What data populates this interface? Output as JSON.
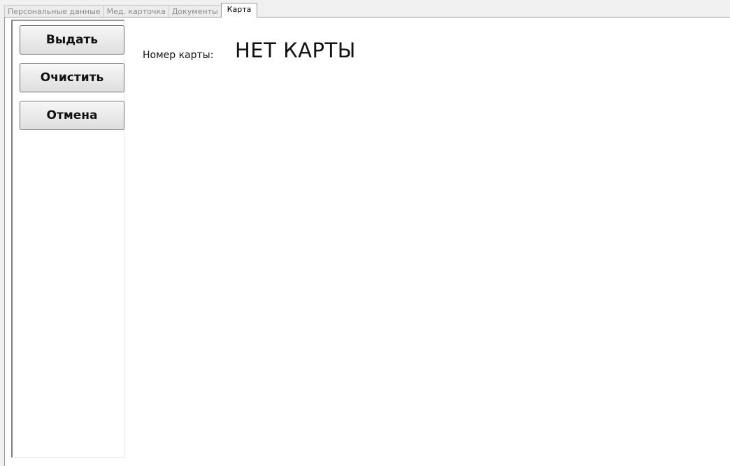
{
  "tabs": [
    {
      "label": "Персональные данные",
      "active": false
    },
    {
      "label": "Мед. карточка",
      "active": false
    },
    {
      "label": "Документы",
      "active": false
    },
    {
      "label": "Карта",
      "active": true
    }
  ],
  "actions": {
    "issue_label": "Выдать",
    "clear_label": "Очистить",
    "cancel_label": "Отмена"
  },
  "card": {
    "label": "Номер карты:",
    "value": "НЕТ КАРТЫ"
  }
}
